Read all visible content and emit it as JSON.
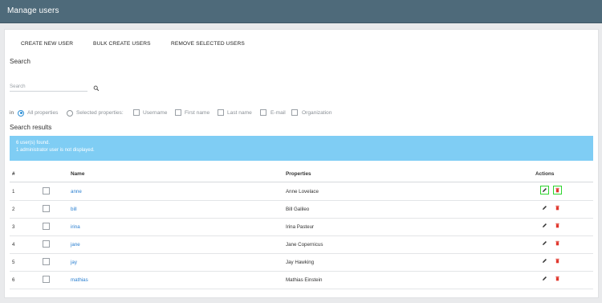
{
  "header": {
    "title": "Manage users"
  },
  "toolbar": {
    "create_new_user": "CREATE NEW USER",
    "bulk_create_users": "BULK CREATE USERS",
    "remove_selected_users": "REMOVE SELECTED USERS"
  },
  "search": {
    "title": "Search",
    "placeholder": "Search",
    "value": "",
    "in_label": "in",
    "all_properties": "All properties",
    "selected_properties": "Selected properties:",
    "mode_selected": "All properties",
    "properties": [
      "Username",
      "First name",
      "Last name",
      "E-mail",
      "Organization"
    ]
  },
  "results": {
    "title": "Search results",
    "found_text": "6 user(s) found.",
    "admin_note": "1 administrator user is not displayed."
  },
  "table": {
    "headers": {
      "num": "#",
      "name": "Name",
      "properties": "Properties",
      "actions": "Actions"
    },
    "rows": [
      {
        "num": "1",
        "name": "anne",
        "properties": "Anne Lovelace"
      },
      {
        "num": "2",
        "name": "bill",
        "properties": "Bill Galileo"
      },
      {
        "num": "3",
        "name": "irina",
        "properties": "Irina Pasteur"
      },
      {
        "num": "4",
        "name": "jane",
        "properties": "Jane Copernicus"
      },
      {
        "num": "5",
        "name": "jay",
        "properties": "Jay Hawking"
      },
      {
        "num": "6",
        "name": "mathias",
        "properties": "Mathias Einstein"
      }
    ]
  },
  "colors": {
    "header_bg": "#4e6a7a",
    "info_bg": "#7fcdf4",
    "link": "#2a7fd0",
    "delete_icon": "#e0362c",
    "highlight": "#2ed52e"
  },
  "icons": {
    "search": "search-icon",
    "edit": "pencil-icon",
    "delete": "trash-icon"
  }
}
